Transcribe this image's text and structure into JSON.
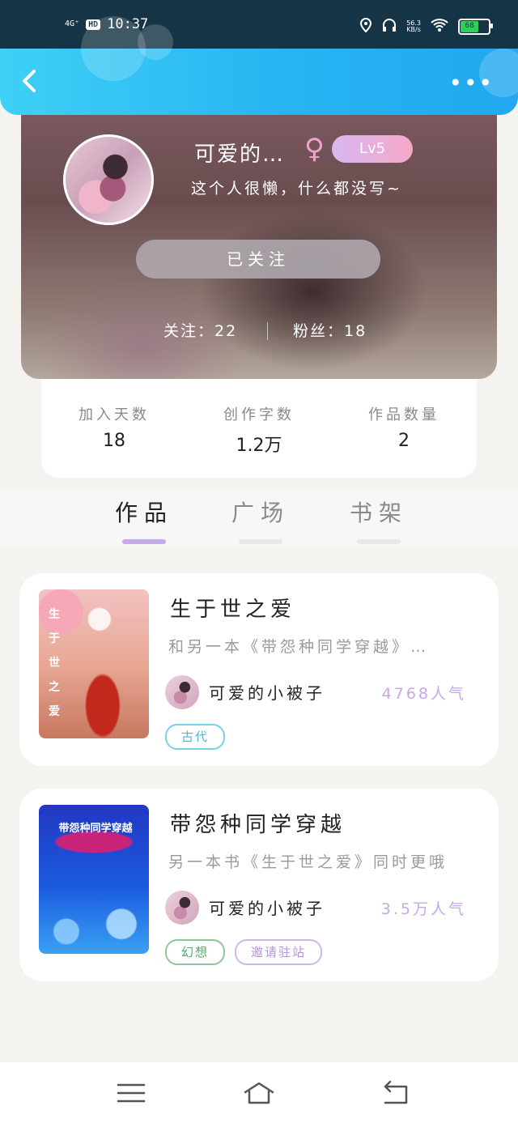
{
  "status_bar": {
    "network": "4G⁺",
    "hd": "HD",
    "time": "10:37",
    "net_speed": "56.3\nKB/s",
    "battery": "68",
    "battery_color": "#2ed158"
  },
  "header": {
    "back_icon": "chevron-left-icon",
    "more_icon": "more-dots-icon",
    "more_label": "•••",
    "gradient_start": "#3fd0f5",
    "gradient_end": "#21a8f0"
  },
  "profile": {
    "name": "可爱的…",
    "gender_symbol": "♀",
    "level": "Lv5",
    "bio": "这个人很懒，什么都没写~",
    "follow_button": "已关注",
    "following": "关注：22",
    "fans": "粉丝：18"
  },
  "counts": [
    {
      "label": "加入天数",
      "value": "18"
    },
    {
      "label": "创作字数",
      "value": "1.2万"
    },
    {
      "label": "作品数量",
      "value": "2"
    }
  ],
  "tabs": [
    {
      "label": "作品",
      "active": true
    },
    {
      "label": "广场",
      "active": false
    },
    {
      "label": "书架",
      "active": false
    }
  ],
  "books": [
    {
      "title": "生于世之爱",
      "description": "和另一本《带怨种同学穿越》…",
      "author": "可爱的小被子",
      "popularity": "4768人气",
      "tags": [
        {
          "label": "古代",
          "color": "#4fb8cf"
        }
      ],
      "cover_text": "生于世之爱"
    },
    {
      "title": "带怨种同学穿越",
      "description": "另一本书《生于世之爱》同时更哦",
      "author": "可爱的小被子",
      "popularity": "3.5万人气",
      "tags": [
        {
          "label": "幻想",
          "color": "#5aa56a"
        },
        {
          "label": "邀请驻站",
          "color": "#b890e0"
        }
      ],
      "cover_text": "带怨种同学穿越"
    }
  ],
  "bottom_nav": {
    "menu_icon": "menu-icon",
    "home_icon": "home-icon",
    "back_icon": "return-icon"
  },
  "accent_color": "#c6a8e8"
}
